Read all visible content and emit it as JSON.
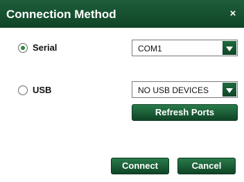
{
  "dialog": {
    "title": "Connection Method",
    "close_glyph": "×"
  },
  "options": {
    "serial": {
      "label": "Serial",
      "selected": true,
      "dropdown_value": "COM1"
    },
    "usb": {
      "label": "USB",
      "selected": false,
      "dropdown_value": "NO USB DEVICES"
    }
  },
  "buttons": {
    "refresh": "Refresh Ports",
    "connect": "Connect",
    "cancel": "Cancel"
  },
  "colors": {
    "accent": "#0f4426",
    "radio_dot": "#2c8a3a"
  }
}
